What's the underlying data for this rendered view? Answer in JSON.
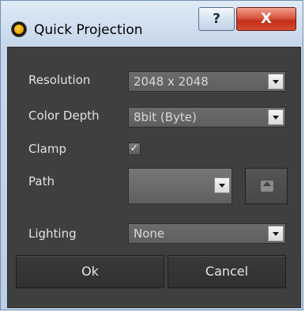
{
  "window": {
    "title": "Quick Projection",
    "help_label": "?",
    "close_label": "X"
  },
  "fields": {
    "resolution": {
      "label": "Resolution",
      "value": "2048 x 2048"
    },
    "color_depth": {
      "label": "Color Depth",
      "value": "8bit (Byte)"
    },
    "clamp": {
      "label": "Clamp",
      "checked": true,
      "mark": "✓"
    },
    "path": {
      "label": "Path",
      "value": ""
    },
    "lighting": {
      "label": "Lighting",
      "value": "None"
    }
  },
  "buttons": {
    "ok": "Ok",
    "cancel": "Cancel"
  },
  "icons": {
    "app": "app-logo-icon",
    "dropdown": "chevron-down-icon",
    "upload": "upload-icon"
  }
}
